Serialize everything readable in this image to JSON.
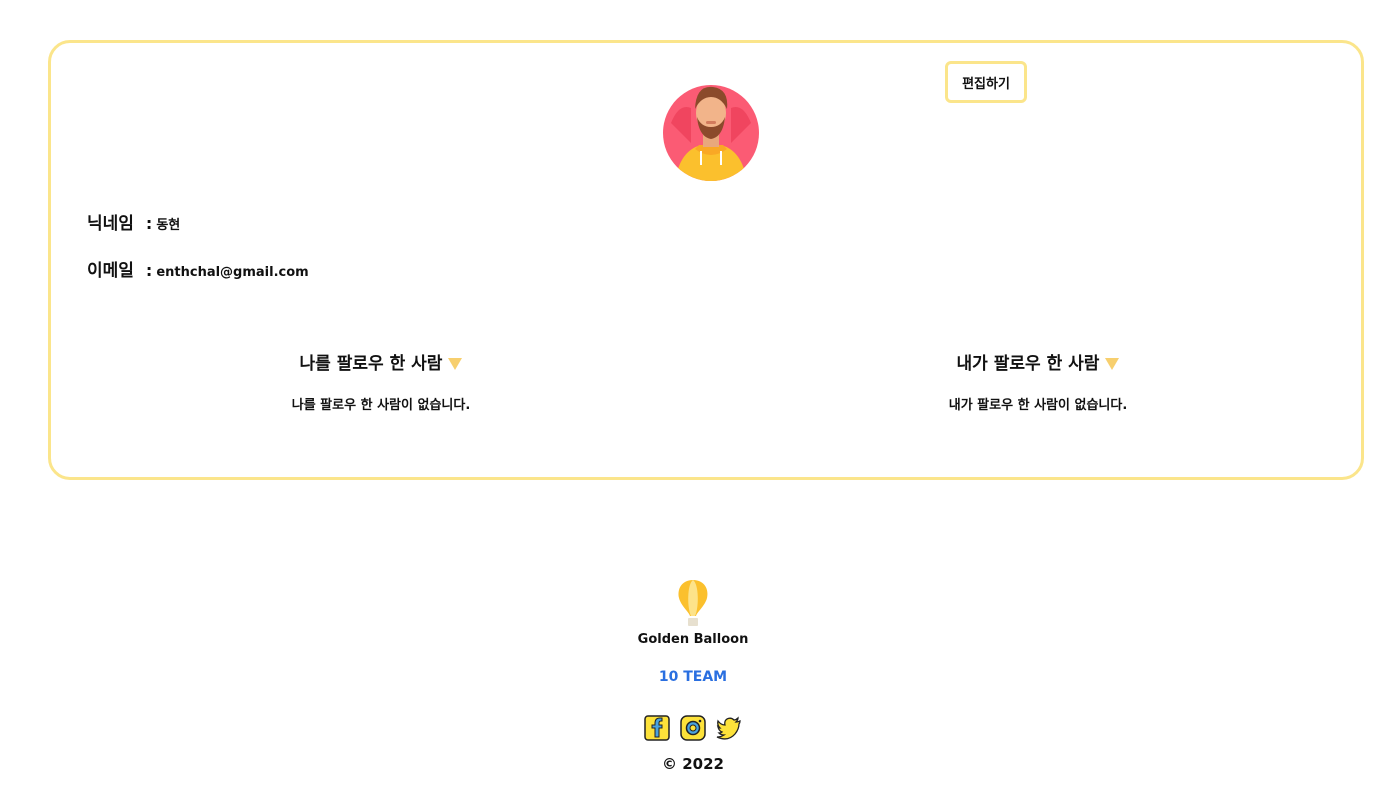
{
  "profile": {
    "edit_label": "편집하기",
    "nickname_label": "닉네임",
    "nickname_value": "동현",
    "email_label": "이메일",
    "email_value": "enthchal@gmail.com",
    "colon": ":"
  },
  "followers": {
    "title": "나를 팔로우 한 사람",
    "empty": "나를 팔로우 한 사람이 없습니다."
  },
  "following": {
    "title": "내가 팔로우 한 사람",
    "empty": "내가 팔로우 한 사람이 없습니다."
  },
  "footer": {
    "brand": "Golden Balloon",
    "team": "10 TEAM",
    "copyright": "© 2022",
    "socials": [
      "facebook-icon",
      "instagram-icon",
      "twitter-icon"
    ]
  },
  "colors": {
    "accent_border": "#fbe58b",
    "triangle": "#f7cf6e",
    "link": "#2a6fe0"
  }
}
